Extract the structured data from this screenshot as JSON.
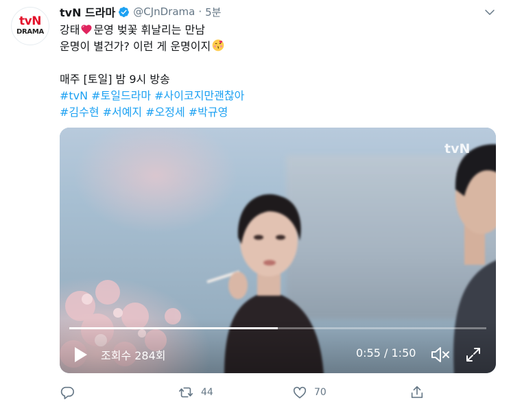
{
  "tweet": {
    "avatar": {
      "logo_top": "tvN",
      "logo_bottom": "DRAMA"
    },
    "display_name": "tvN 드라마",
    "handle": "@CJnDrama",
    "separator": "·",
    "time": "5분",
    "lines": [
      {
        "before": "강태",
        "emoji": "heart-icon",
        "after": "문영 벚꽃 휘날리는 만남"
      },
      {
        "before": "운명이 별건가? 이런 게 운명이지",
        "emoji": "kissing-face-icon",
        "after": ""
      }
    ],
    "broadcast": "매주 [토일] 밤 9시 방송",
    "hashtags_line1": [
      "#tvN",
      "#토일드라마",
      "#사이코지만괜찮아"
    ],
    "hashtags_line2": [
      "#김수현",
      "#서예지",
      "#오정세",
      "#박규영"
    ]
  },
  "video": {
    "watermark": "tvN",
    "views": "조회수 284회",
    "time_display": "0:55 / 1:50",
    "progress": 0.5
  },
  "actions": {
    "reply_count": "",
    "retweet_count": "44",
    "like_count": "70"
  },
  "colors": {
    "text": "#14171a",
    "muted": "#657786",
    "link": "#1da1f2",
    "verified": "#1da1f2",
    "brand_red": "#e3122b"
  },
  "icons": [
    "verified-badge-icon",
    "chevron-down-icon",
    "play-icon",
    "mute-icon",
    "fullscreen-icon",
    "reply-icon",
    "retweet-icon",
    "like-icon",
    "share-icon"
  ]
}
